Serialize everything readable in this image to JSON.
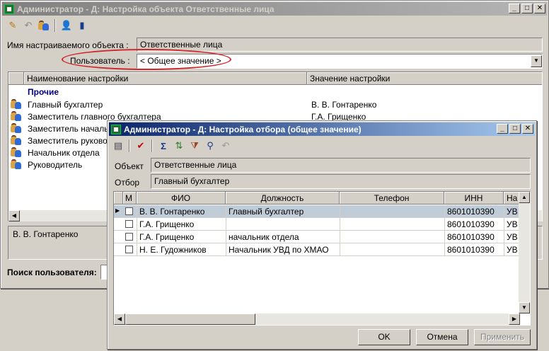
{
  "main_window": {
    "title": "Администратор - Д: Настройка объекта Ответственные лица",
    "object_label": "Имя настраиваемого объекта :",
    "object_value": "Ответственные лица",
    "user_label": "Пользователь :",
    "user_value": "< Общее значение >",
    "columns": [
      "Наименование настройки",
      "Значение настройки"
    ],
    "group_label": "Прочие",
    "rows": [
      {
        "name": "Главный бухгалтер",
        "value": "В. В. Гонтаренко"
      },
      {
        "name": "Заместитель главного бухгалтера",
        "value": "Г.А. Грищенко"
      },
      {
        "name": "Заместитель начальника",
        "value": ""
      },
      {
        "name": "Заместитель руководителя",
        "value": ""
      },
      {
        "name": "Начальник отдела",
        "value": ""
      },
      {
        "name": "Руководитель",
        "value": ""
      }
    ],
    "detail_value": "В. В. Гонтаренко",
    "search_label": "Поиск пользователя:"
  },
  "dialog": {
    "title": "Администратор - Д: Настройка отбора (общее значение)",
    "object_label": "Объект",
    "object_value": "Ответственные лица",
    "filter_label": "Отбор",
    "filter_value": "Главный бухгалтер",
    "columns": [
      "М",
      "ФИО",
      "Должность",
      "Телефон",
      "ИНН",
      "На"
    ],
    "rows": [
      {
        "fio": "В. В. Гонтаренко",
        "position": "Главный бухгалтер",
        "phone": "",
        "inn": "8601010390",
        "na": "УВ",
        "selected": true
      },
      {
        "fio": "Г.А. Грищенко",
        "position": "",
        "phone": "",
        "inn": "8601010390",
        "na": "УВ",
        "selected": false
      },
      {
        "fio": "Г.А. Грищенко",
        "position": "начальник отдела",
        "phone": "",
        "inn": "8601010390",
        "na": "УВ",
        "selected": false
      },
      {
        "fio": "Н. Е. Гудожников",
        "position": "Начальник УВД по ХМАО",
        "phone": "",
        "inn": "8601010390",
        "na": "УВ",
        "selected": false
      }
    ],
    "ok_label": "OK",
    "cancel_label": "Отмена",
    "apply_label": "Применить"
  },
  "colors": {
    "active_title": "#0a246a",
    "inactive_title": "#808080",
    "highlight": "#ff0000",
    "selected_row": "#c0ccd8",
    "group_text": "#000080"
  }
}
